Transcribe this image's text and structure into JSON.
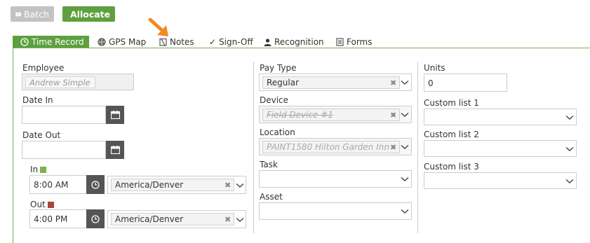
{
  "toolbar": {
    "batch_label": "Batch",
    "allocate_label": "Allocate"
  },
  "tabs": [
    {
      "label": "Time Record",
      "icon": "clock-icon",
      "active": true
    },
    {
      "label": "GPS Map",
      "icon": "globe-icon"
    },
    {
      "label": "Notes",
      "icon": "note-icon"
    },
    {
      "label": "Sign-Off",
      "icon": "check-icon"
    },
    {
      "label": "Recognition",
      "icon": "user-icon"
    },
    {
      "label": "Forms",
      "icon": "form-icon"
    }
  ],
  "left": {
    "employee_label": "Employee",
    "employee_value": "Andrew Simple",
    "date_in_label": "Date In",
    "date_out_label": "Date Out",
    "in_label": "In",
    "in_time": "8:00 AM",
    "in_timezone": "America/Denver",
    "out_label": "Out",
    "out_time": "4:00 PM",
    "out_timezone": "America/Denver",
    "in_color": "#7cb342",
    "out_color": "#a94442"
  },
  "middle": {
    "pay_type_label": "Pay Type",
    "pay_type_value": "Regular",
    "device_label": "Device",
    "device_value": "Field Device #1",
    "location_label": "Location",
    "location_value": "PAINT1580 Hilton Garden Inn",
    "task_label": "Task",
    "asset_label": "Asset"
  },
  "right": {
    "units_label": "Units",
    "units_value": "0",
    "custom1_label": "Custom list 1",
    "custom2_label": "Custom list 2",
    "custom3_label": "Custom list 3"
  },
  "colors": {
    "accent": "#5ea03f",
    "disabled_button": "#c3c3c3"
  }
}
